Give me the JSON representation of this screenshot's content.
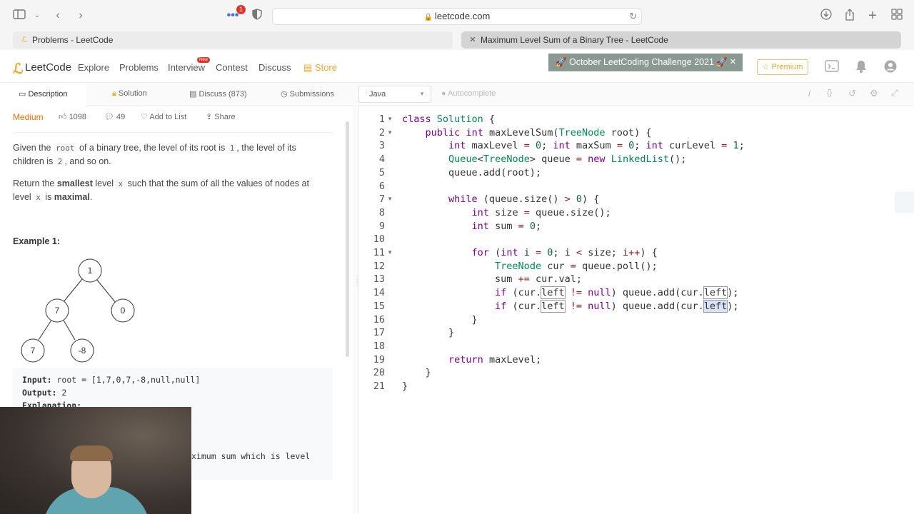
{
  "browser": {
    "url": "leetcode.com",
    "notification_count": "1",
    "tabs": [
      {
        "label": "Problems - LeetCode",
        "active": false
      },
      {
        "label": "Maximum Level Sum of a Binary Tree - LeetCode",
        "active": true
      }
    ]
  },
  "nav": {
    "logo": "LeetCode",
    "links": {
      "explore": "Explore",
      "problems": "Problems",
      "interview": "Interview",
      "contest": "Contest",
      "discuss": "Discuss",
      "store": "Store"
    },
    "new_badge": "New",
    "challenge_banner": "🚀 October LeetCoding Challenge 2021 🚀",
    "premium": "Premium",
    "accent_color": "#f0a531"
  },
  "problem_tabs": {
    "description": "Description",
    "solution": "Solution",
    "discuss": "Discuss (873)",
    "submissions": "Submissions"
  },
  "editor_bar": {
    "language": "Java",
    "autocomplete": "Autocomplete"
  },
  "problem": {
    "difficulty": "Medium",
    "likes": "1098",
    "dislikes": "49",
    "add_to_list": "Add to List",
    "share": "Share",
    "p1_a": "Given the ",
    "p1_code1": "root",
    "p1_b": " of a binary tree, the level of its root is ",
    "p1_code2": "1",
    "p1_c": ", the level of its children is ",
    "p1_code3": "2",
    "p1_d": ", and so on.",
    "p2_a": "Return the ",
    "p2_bold1": "smallest",
    "p2_b": " level ",
    "p2_code": "x",
    "p2_c": " such that the sum of all the values of nodes at level ",
    "p2_code2": "x",
    "p2_d": " is ",
    "p2_bold2": "maximal",
    "p2_e": ".",
    "example_title": "Example 1:",
    "tree_nodes": [
      "1",
      "7",
      "0",
      "7",
      "-8"
    ],
    "input_label": "Input:",
    "input_value": " root = [1,7,0,7,-8,null,null]",
    "output_label": "Output:",
    "output_value": " 2",
    "explanation_label": "Explanation:",
    "explanation_partial": "ximum sum which is level"
  },
  "code": {
    "line_numbers": [
      "1",
      "2",
      "3",
      "4",
      "5",
      "6",
      "7",
      "8",
      "9",
      "10",
      "11",
      "12",
      "13",
      "14",
      "15",
      "16",
      "17",
      "18",
      "19",
      "20",
      "21"
    ],
    "lines": [
      "class Solution {",
      "    public int maxLevelSum(TreeNode root) {",
      "        int maxLevel = 0; int maxSum = 0; int curLevel = 1;",
      "        Queue<TreeNode> queue = new LinkedList();",
      "        queue.add(root);",
      "",
      "        while (queue.size() > 0) {",
      "            int size = queue.size();",
      "            int sum = 0;",
      "",
      "            for (int i = 0; i < size; i++) {",
      "                TreeNode cur = queue.poll();",
      "                sum += cur.val;",
      "                if (cur.left != null) queue.add(cur.left);",
      "                if (cur.left != null) queue.add(cur.left);",
      "            }",
      "        }",
      "",
      "        return maxLevel;",
      "    }",
      "}"
    ]
  }
}
